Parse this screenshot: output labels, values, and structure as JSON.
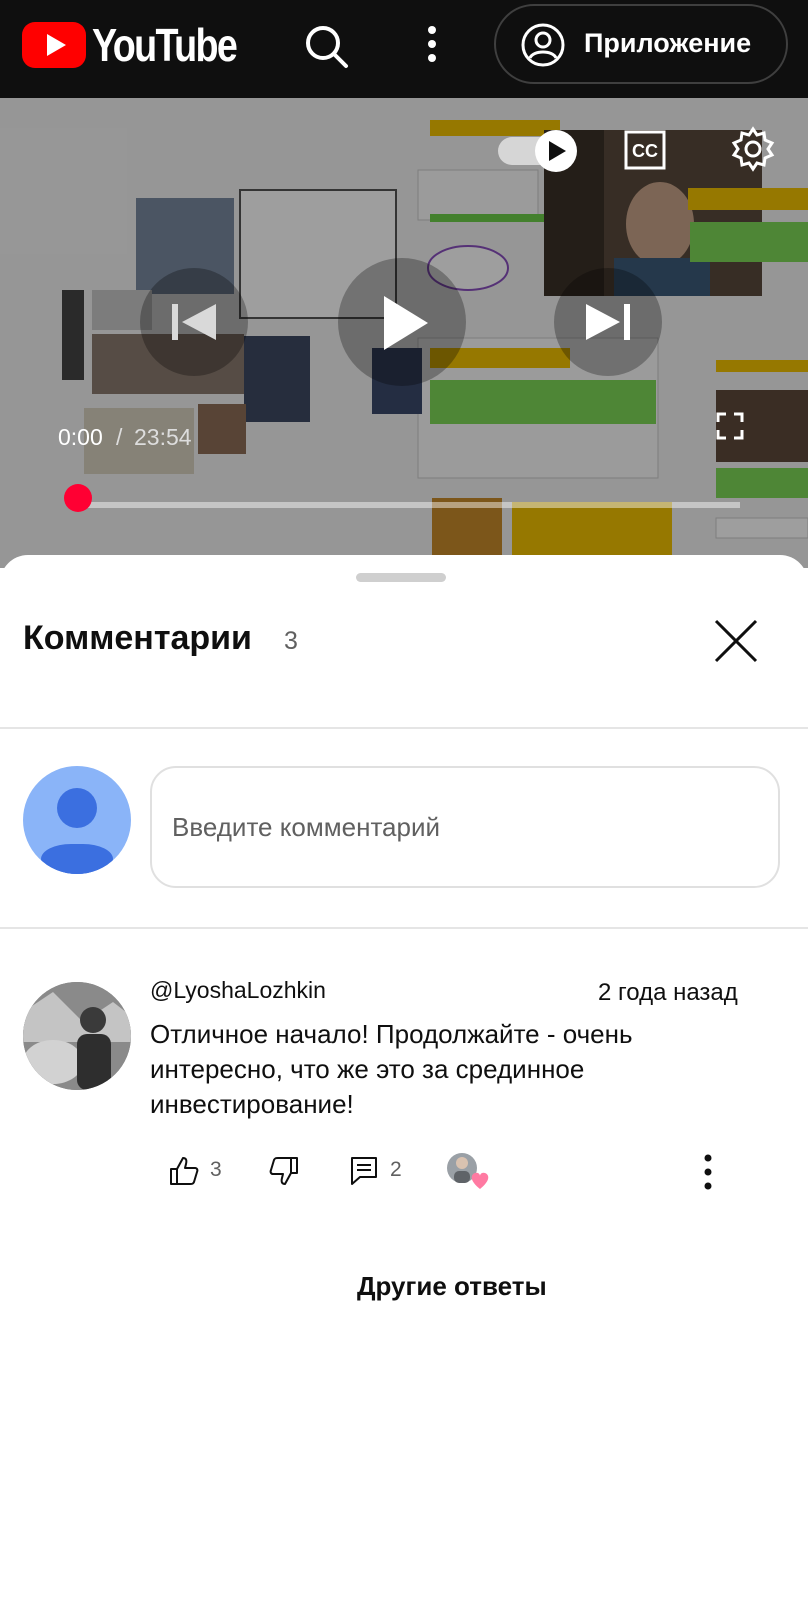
{
  "header": {
    "logo_text": "YouTube",
    "app_button_label": "Приложение",
    "icons": [
      "search-icon",
      "more-vert-icon",
      "account-circle-icon"
    ]
  },
  "player": {
    "current_time": "0:00",
    "separator": "/",
    "duration": "23:54",
    "progress": 0,
    "autoplay": true,
    "icons": [
      "autoplay-toggle-icon",
      "closed-captions-icon",
      "settings-gear-icon",
      "previous-icon",
      "play-icon",
      "next-icon",
      "fullscreen-icon"
    ]
  },
  "comments_panel": {
    "title": "Комментарии",
    "count": "3",
    "input_placeholder": "Введите комментарий",
    "comments": [
      {
        "author": "@LyoshaLozhkin",
        "time": "2 года назад",
        "text": "Отличное начало! Продолжайте - очень интересно, что же это за срединное инвестирование!",
        "likes": "3",
        "replies": "2"
      }
    ],
    "more_replies_label": "Другие ответы"
  },
  "colors": {
    "brand_red": "#ff0000",
    "header_bg": "#0f0f0f",
    "avatar_placeholder": "#8ab4f8"
  }
}
